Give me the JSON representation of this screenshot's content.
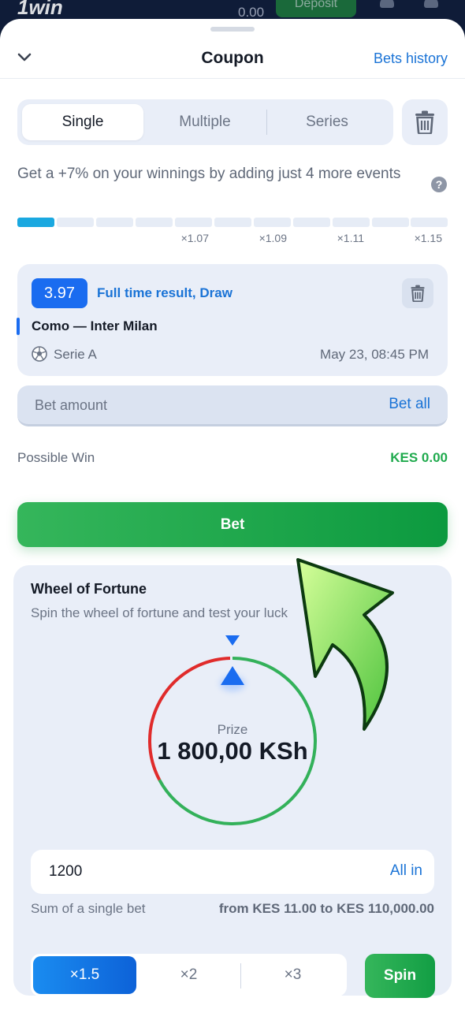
{
  "topbar": {
    "logo": "1win",
    "balance": "0.00",
    "deposit_label": "Deposit"
  },
  "header": {
    "title": "Coupon",
    "history_link": "Bets history"
  },
  "tabs": [
    {
      "label": "Single",
      "active": true
    },
    {
      "label": "Multiple",
      "active": false
    },
    {
      "label": "Series",
      "active": false
    }
  ],
  "promo": {
    "text": "Get a +7% on your winnings by adding just 4 more events",
    "progress_filled_segments": 1,
    "progress_total_segments": 11,
    "multipliers": [
      "×1.07",
      "×1.09",
      "×1.11",
      "×1.15"
    ]
  },
  "bet_card": {
    "odds": "3.97",
    "market": "Full time result, Draw",
    "match": "Como — Inter Milan",
    "league": "Serie A",
    "date": "May 23, 08:45 PM"
  },
  "amount": {
    "placeholder": "Bet amount",
    "bet_all_label": "Bet all"
  },
  "possible_win": {
    "label": "Possible Win",
    "value": "KES 0.00"
  },
  "bet_button": "Bet",
  "wheel": {
    "title": "Wheel of Fortune",
    "subtitle": "Spin the wheel of fortune and test your luck",
    "prize_label": "Prize",
    "prize_value": "1 800,00 KSh",
    "sum_value": "1200",
    "all_in_label": "All in",
    "sum_caption": "Sum of a single bet",
    "range": "from KES 11.00 to KES 110,000.00",
    "multipliers": [
      {
        "label": "×1.5",
        "active": true
      },
      {
        "label": "×2",
        "active": false
      },
      {
        "label": "×3",
        "active": false
      }
    ],
    "spin_label": "Spin"
  },
  "colors": {
    "accent_blue": "#1a73d6",
    "green": "#1faa4d",
    "wheel_red": "#e02b2b",
    "wheel_green": "#33b15a"
  }
}
